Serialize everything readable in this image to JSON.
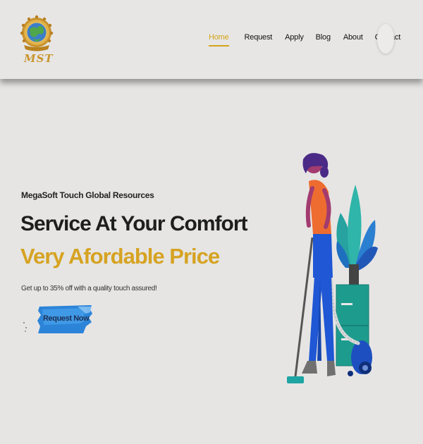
{
  "brand": {
    "logo_icon": "globe-emblem-logo",
    "logo_text": "MST"
  },
  "nav": {
    "items": [
      {
        "label": "Home",
        "active": true
      },
      {
        "label": "Request",
        "active": false
      },
      {
        "label": "Apply",
        "active": false
      },
      {
        "label": "Blog",
        "active": false
      },
      {
        "label": "About",
        "active": false
      },
      {
        "label": "Contact",
        "active": false
      }
    ],
    "accent_color": "#d4a51a"
  },
  "hero": {
    "kicker": "MegaSoft Touch Global Resources",
    "title": "Service At Your Comfort",
    "subtitle": "Very Afordable Price",
    "description": "Get up to 35% off with a quality touch assured!",
    "cta_label": "Request Now",
    "subtitle_color": "#d6a322",
    "illustration": "woman-vacuuming-illustration"
  }
}
